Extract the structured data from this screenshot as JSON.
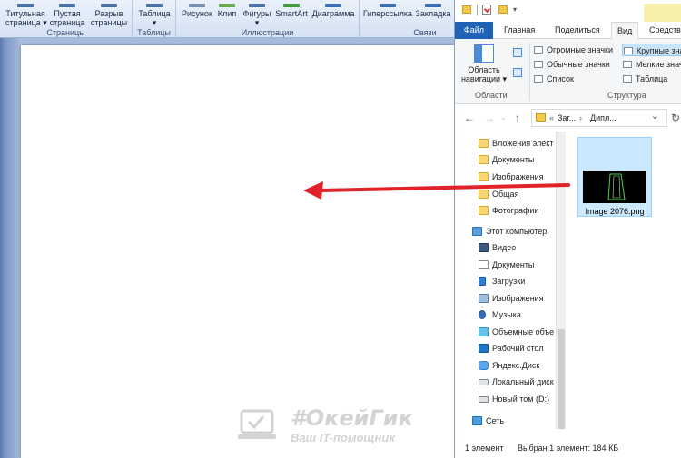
{
  "word": {
    "ribbon": {
      "groups": [
        {
          "name": "Страницы",
          "buttons": [
            "Титульная\nстраница ▾",
            "Пустая\nстраница",
            "Разрыв\nстраницы"
          ]
        },
        {
          "name": "Таблицы",
          "buttons": [
            "Таблица\n▾"
          ]
        },
        {
          "name": "Иллюстрации",
          "buttons": [
            "Рисунок",
            "Клип",
            "Фигуры\n▾",
            "SmartArt",
            "Диаграмма"
          ]
        },
        {
          "name": "Связи",
          "buttons": [
            "Гиперссылка",
            "Закладка"
          ]
        }
      ]
    }
  },
  "explorer": {
    "tabs": [
      "Файл",
      "Главная",
      "Поделиться",
      "Вид",
      "Средства"
    ],
    "active_tab": "Вид",
    "ribbon": {
      "nav_pane_button": "Область\nнавигации ▾",
      "group_panes": "Области",
      "group_layout": "Структура",
      "layout_options": [
        "Огромные значки",
        "Крупные значки",
        "Обычные значки",
        "Мелкие значки",
        "Список",
        "Таблица"
      ],
      "selected_layout": "Крупные значки"
    },
    "address": {
      "path_parts": [
        "«",
        "Заг...",
        "›",
        "Дипл..."
      ],
      "chevron": "⌄"
    },
    "nav_items": [
      {
        "label": "Вложения элект",
        "icon": "folder-icon",
        "indent": 1
      },
      {
        "label": "Документы",
        "icon": "folder-icon",
        "indent": 1
      },
      {
        "label": "Изображения",
        "icon": "folder-icon",
        "indent": 1
      },
      {
        "label": "Общая",
        "icon": "folder-icon",
        "indent": 1
      },
      {
        "label": "Фотографии",
        "icon": "folder-icon",
        "indent": 1
      },
      {
        "label": "Этот компьютер",
        "icon": "computer-icon",
        "indent": 0
      },
      {
        "label": "Видео",
        "icon": "video-icon",
        "indent": 1
      },
      {
        "label": "Документы",
        "icon": "documents-icon",
        "indent": 1
      },
      {
        "label": "Загрузки",
        "icon": "downloads-icon",
        "indent": 1
      },
      {
        "label": "Изображения",
        "icon": "pictures-icon",
        "indent": 1
      },
      {
        "label": "Музыка",
        "icon": "music-icon",
        "indent": 1
      },
      {
        "label": "Объемные объе",
        "icon": "objects3d-icon",
        "indent": 1
      },
      {
        "label": "Рабочий стол",
        "icon": "desktop-icon",
        "indent": 1
      },
      {
        "label": "Яндекс.Диск",
        "icon": "yandex-disk-icon",
        "indent": 1
      },
      {
        "label": "Локальный диск",
        "icon": "drive-icon",
        "indent": 1
      },
      {
        "label": "Новый том (D:)",
        "icon": "drive-icon",
        "indent": 1
      },
      {
        "label": "Сеть",
        "icon": "network-icon",
        "indent": 0
      }
    ],
    "file": {
      "name": "Image 2076.png"
    },
    "status": {
      "count": "1 элемент",
      "selected": "Выбран 1 элемент: 184 КБ"
    }
  },
  "watermark": {
    "main": "#ОкейГик",
    "sub": "Ваш IT-помощник"
  },
  "colors": {
    "file_tab": "#1e63b5",
    "selection": "#cce8ff",
    "arrow": "#e0232b"
  }
}
